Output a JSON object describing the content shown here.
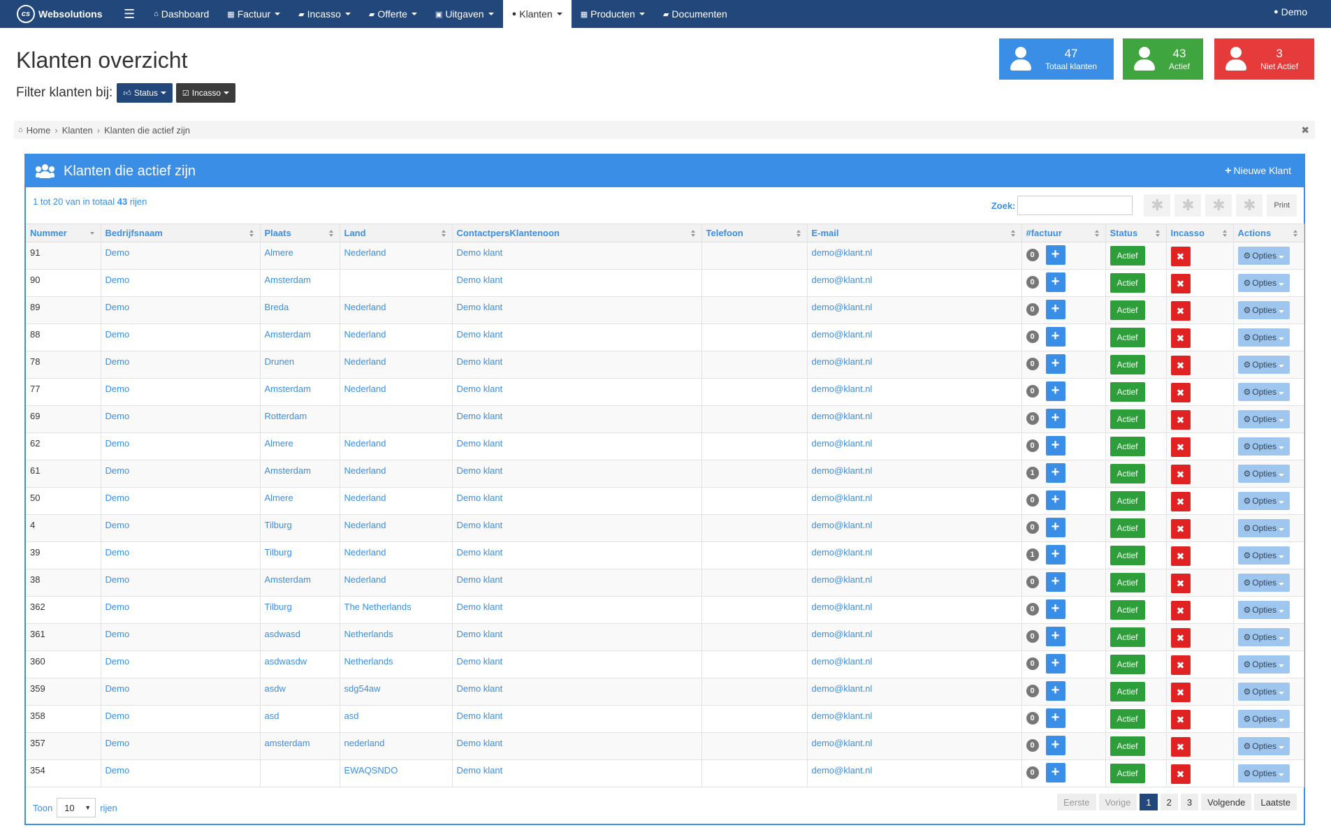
{
  "nav": {
    "brand": "Websolutions",
    "brand_logo": "cs",
    "items": [
      {
        "label": "Dashboard",
        "icon": "home-icon",
        "glyph": "⌂",
        "dropdown": false,
        "active": false
      },
      {
        "label": "Factuur",
        "icon": "table-icon",
        "glyph": "▦",
        "dropdown": true,
        "active": false
      },
      {
        "label": "Incasso",
        "icon": "book-icon",
        "glyph": "▰",
        "dropdown": true,
        "active": false
      },
      {
        "label": "Offerte",
        "icon": "book-icon",
        "glyph": "▰",
        "dropdown": true,
        "active": false
      },
      {
        "label": "Uitgaven",
        "icon": "briefcase-icon",
        "glyph": "▣",
        "dropdown": true,
        "active": false
      },
      {
        "label": "Klanten",
        "icon": "user-icon",
        "glyph": "●",
        "dropdown": true,
        "active": true
      },
      {
        "label": "Producten",
        "icon": "table-icon",
        "glyph": "▦",
        "dropdown": true,
        "active": false
      },
      {
        "label": "Documenten",
        "icon": "book-icon",
        "glyph": "▰",
        "dropdown": false,
        "active": false
      }
    ],
    "user": "Demo"
  },
  "header": {
    "title": "Klanten overzicht",
    "filter_label": "Filter klanten bij:",
    "filter_status": "Status",
    "filter_incasso": "Incasso"
  },
  "stats": [
    {
      "value": "47",
      "label": "Totaal klanten",
      "color": "#3a8ee6"
    },
    {
      "value": "43",
      "label": "Actief",
      "color": "#3fa53f"
    },
    {
      "value": "3",
      "label": "Niet Actief",
      "color": "#e53b3b"
    }
  ],
  "breadcrumb": [
    "Home",
    "Klanten",
    "Klanten die actief zijn"
  ],
  "panel": {
    "title": "Klanten die actief zijn",
    "new_button": "Nieuwe Klant",
    "info_prefix": "1 tot 20 van in totaal",
    "info_total": "43",
    "info_suffix": "rijen",
    "search_label": "Zoek:",
    "search_value": "",
    "print_label": "Print"
  },
  "columns": [
    "Nummer",
    "Bedrijfsnaam",
    "Plaats",
    "Land",
    "ContactpersKlantenoon",
    "Telefoon",
    "E-mail",
    "#factuur",
    "Status",
    "Incasso",
    "Actions"
  ],
  "rows": [
    {
      "nummer": "91",
      "bedrijf": "Demo",
      "plaats": "Almere",
      "land": "Nederland",
      "contact": "Demo  klant",
      "telefoon": "",
      "email": "demo@klant.nl",
      "facturen": "0",
      "status": "Actief",
      "opties": "Opties"
    },
    {
      "nummer": "90",
      "bedrijf": "Demo",
      "plaats": "Amsterdam",
      "land": "",
      "contact": "Demo  klant",
      "telefoon": "",
      "email": "demo@klant.nl",
      "facturen": "0",
      "status": "Actief",
      "opties": "Opties"
    },
    {
      "nummer": "89",
      "bedrijf": "Demo",
      "plaats": "Breda",
      "land": "Nederland",
      "contact": "Demo  klant",
      "telefoon": "",
      "email": "demo@klant.nl",
      "facturen": "0",
      "status": "Actief",
      "opties": "Opties"
    },
    {
      "nummer": "88",
      "bedrijf": "Demo",
      "plaats": "Amsterdam",
      "land": "Nederland",
      "contact": "Demo  klant",
      "telefoon": "",
      "email": "demo@klant.nl",
      "facturen": "0",
      "status": "Actief",
      "opties": "Opties"
    },
    {
      "nummer": "78",
      "bedrijf": "Demo",
      "plaats": "Drunen",
      "land": "Nederland",
      "contact": "Demo  klant",
      "telefoon": "",
      "email": "demo@klant.nl",
      "facturen": "0",
      "status": "Actief",
      "opties": "Opties"
    },
    {
      "nummer": "77",
      "bedrijf": "Demo",
      "plaats": "Amsterdam",
      "land": "Nederland",
      "contact": "Demo  klant",
      "telefoon": "",
      "email": "demo@klant.nl",
      "facturen": "0",
      "status": "Actief",
      "opties": "Opties"
    },
    {
      "nummer": "69",
      "bedrijf": "Demo",
      "plaats": "Rotterdam",
      "land": "",
      "contact": "Demo  klant",
      "telefoon": "",
      "email": "demo@klant.nl",
      "facturen": "0",
      "status": "Actief",
      "opties": "Opties"
    },
    {
      "nummer": "62",
      "bedrijf": "Demo",
      "plaats": "Almere",
      "land": "Nederland",
      "contact": "Demo  klant",
      "telefoon": "",
      "email": "demo@klant.nl",
      "facturen": "0",
      "status": "Actief",
      "opties": "Opties"
    },
    {
      "nummer": "61",
      "bedrijf": "Demo",
      "plaats": "Amsterdam",
      "land": "Nederland",
      "contact": "Demo  klant",
      "telefoon": "",
      "email": "demo@klant.nl",
      "facturen": "1",
      "status": "Actief",
      "opties": "Opties"
    },
    {
      "nummer": "50",
      "bedrijf": "Demo",
      "plaats": "Almere",
      "land": "Nederland",
      "contact": "Demo  klant",
      "telefoon": "",
      "email": "demo@klant.nl",
      "facturen": "0",
      "status": "Actief",
      "opties": "Opties"
    },
    {
      "nummer": "4",
      "bedrijf": "Demo",
      "plaats": "Tilburg",
      "land": "Nederland",
      "contact": "Demo  klant",
      "telefoon": "",
      "email": "demo@klant.nl",
      "facturen": "0",
      "status": "Actief",
      "opties": "Opties"
    },
    {
      "nummer": "39",
      "bedrijf": "Demo",
      "plaats": "Tilburg",
      "land": "Nederland",
      "contact": "Demo  klant",
      "telefoon": "",
      "email": "demo@klant.nl",
      "facturen": "1",
      "status": "Actief",
      "opties": "Opties"
    },
    {
      "nummer": "38",
      "bedrijf": "Demo",
      "plaats": "Amsterdam",
      "land": "Nederland",
      "contact": "Demo  klant",
      "telefoon": "",
      "email": "demo@klant.nl",
      "facturen": "0",
      "status": "Actief",
      "opties": "Opties"
    },
    {
      "nummer": "362",
      "bedrijf": "Demo",
      "plaats": "Tilburg",
      "land": "The Netherlands",
      "contact": "Demo  klant",
      "telefoon": "",
      "email": "demo@klant.nl",
      "facturen": "0",
      "status": "Actief",
      "opties": "Opties"
    },
    {
      "nummer": "361",
      "bedrijf": "Demo",
      "plaats": "asdwasd",
      "land": "Netherlands",
      "contact": "Demo  klant",
      "telefoon": "",
      "email": "demo@klant.nl",
      "facturen": "0",
      "status": "Actief",
      "opties": "Opties"
    },
    {
      "nummer": "360",
      "bedrijf": "Demo",
      "plaats": "asdwasdw",
      "land": "Netherlands",
      "contact": "Demo  klant",
      "telefoon": "",
      "email": "demo@klant.nl",
      "facturen": "0",
      "status": "Actief",
      "opties": "Opties"
    },
    {
      "nummer": "359",
      "bedrijf": "Demo",
      "plaats": "asdw",
      "land": "sdg54aw",
      "contact": "Demo  klant",
      "telefoon": "",
      "email": "demo@klant.nl",
      "facturen": "0",
      "status": "Actief",
      "opties": "Opties"
    },
    {
      "nummer": "358",
      "bedrijf": "Demo",
      "plaats": "asd",
      "land": "asd",
      "contact": "Demo  klant",
      "telefoon": "",
      "email": "demo@klant.nl",
      "facturen": "0",
      "status": "Actief",
      "opties": "Opties"
    },
    {
      "nummer": "357",
      "bedrijf": "Demo",
      "plaats": "amsterdam",
      "land": "nederland",
      "contact": "Demo  klant",
      "telefoon": "",
      "email": "demo@klant.nl",
      "facturen": "0",
      "status": "Actief",
      "opties": "Opties"
    },
    {
      "nummer": "354",
      "bedrijf": "Demo",
      "plaats": "",
      "land": "EWAQSNDO",
      "contact": "Demo  klant",
      "telefoon": "",
      "email": "demo@klant.nl",
      "facturen": "0",
      "status": "Actief",
      "opties": "Opties"
    }
  ],
  "footer": {
    "toon_label": "Toon",
    "toon_value": "10",
    "rijen_label": "rijen",
    "pages": [
      {
        "label": "Eerste",
        "state": "disabled"
      },
      {
        "label": "Vorige",
        "state": "disabled"
      },
      {
        "label": "1",
        "state": "current"
      },
      {
        "label": "2",
        "state": "normal"
      },
      {
        "label": "3",
        "state": "normal"
      },
      {
        "label": "Volgende",
        "state": "normal"
      },
      {
        "label": "Laatste",
        "state": "normal"
      }
    ]
  },
  "colors": {
    "navbar": "#22477a",
    "accent": "#3a8ee6",
    "success": "#2e9e3a",
    "danger": "#e02222"
  }
}
